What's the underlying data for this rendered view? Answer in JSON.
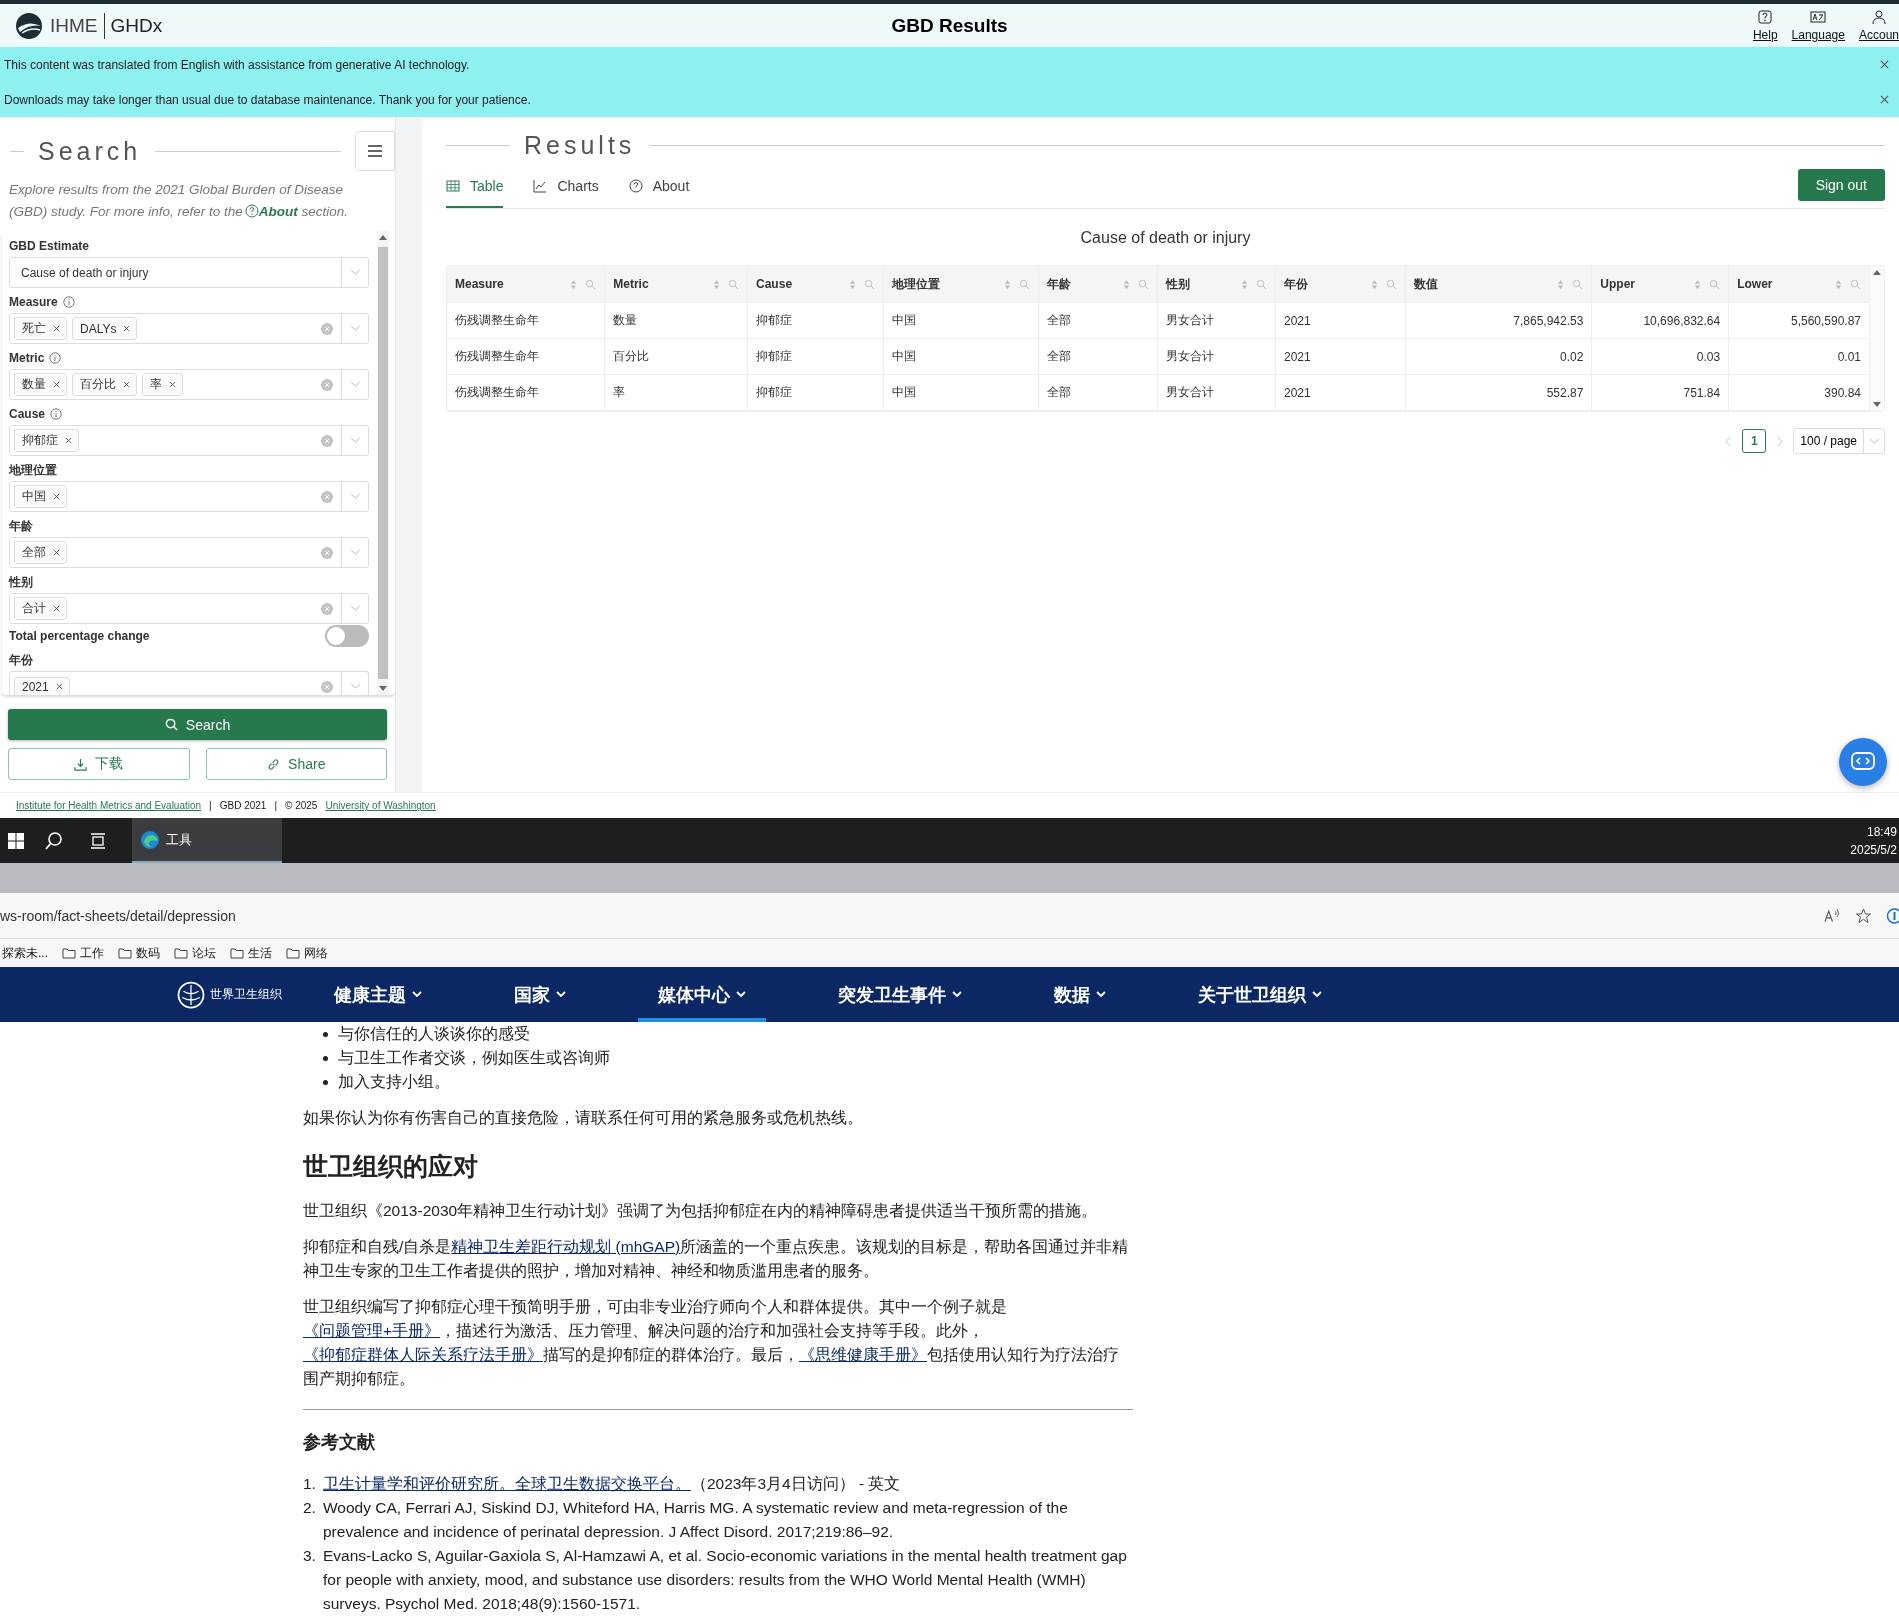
{
  "header": {
    "logo": "IHME",
    "brand": "GHDx",
    "title": "GBD Results",
    "actions": [
      {
        "label": "Help"
      },
      {
        "label": "Language"
      },
      {
        "label": "Accoun"
      }
    ]
  },
  "banners": [
    {
      "text": "This content was translated from English with assistance from generative AI technology."
    },
    {
      "text": "Downloads may take longer than usual due to database maintenance. Thank you for your patience."
    }
  ],
  "search_panel": {
    "title": "Search",
    "intro_before": "Explore results from the 2021 Global Burden of Disease (GBD) study. For more info, refer to the",
    "intro_link": "About",
    "intro_after": "section.",
    "filters": [
      {
        "kind": "select",
        "label": "GBD Estimate",
        "info": false,
        "value": "Cause of death or injury"
      },
      {
        "kind": "tags",
        "label": "Measure",
        "info": true,
        "tags": [
          "死亡",
          "DALYs"
        ]
      },
      {
        "kind": "tags",
        "label": "Metric",
        "info": true,
        "tags": [
          "数量",
          "百分比",
          "率"
        ]
      },
      {
        "kind": "tags",
        "label": "Cause",
        "info": true,
        "tags": [
          "抑郁症"
        ]
      },
      {
        "kind": "tags",
        "label": "地理位置",
        "info": false,
        "tags": [
          "中国"
        ]
      },
      {
        "kind": "tags",
        "label": "年龄",
        "info": false,
        "tags": [
          "全部"
        ]
      },
      {
        "kind": "tags",
        "label": "性别",
        "info": false,
        "tags": [
          "合计"
        ]
      },
      {
        "kind": "toggle",
        "label": "Total percentage change",
        "on": false
      },
      {
        "kind": "tags",
        "label": "年份",
        "info": false,
        "tags": [
          "2021"
        ]
      }
    ],
    "search_button": "Search",
    "download_button": "下载",
    "share_button": "Share"
  },
  "results": {
    "title": "Results",
    "tabs": [
      {
        "label": "Table",
        "selected": true
      },
      {
        "label": "Charts",
        "selected": false
      },
      {
        "label": "About",
        "selected": false
      }
    ],
    "sign_out": "Sign out",
    "table": {
      "caption": "Cause of death or injury",
      "columns": [
        {
          "label": "Measure",
          "kind": "text"
        },
        {
          "label": "Metric",
          "kind": "text"
        },
        {
          "label": "Cause",
          "kind": "text"
        },
        {
          "label": "地理位置",
          "kind": "text"
        },
        {
          "label": "年龄",
          "kind": "text"
        },
        {
          "label": "性别",
          "kind": "text"
        },
        {
          "label": "年份",
          "kind": "text"
        },
        {
          "label": "数值",
          "kind": "number"
        },
        {
          "label": "Upper",
          "kind": "number"
        },
        {
          "label": "Lower",
          "kind": "number"
        }
      ],
      "rows": [
        [
          "伤残调整生命年",
          "数量",
          "抑郁症",
          "中国",
          "全部",
          "男女合计",
          "2021",
          "7,865,942.53",
          "10,696,832.64",
          "5,560,590.87"
        ],
        [
          "伤残调整生命年",
          "百分比",
          "抑郁症",
          "中国",
          "全部",
          "男女合计",
          "2021",
          "0.02",
          "0.03",
          "0.01"
        ],
        [
          "伤残调整生命年",
          "率",
          "抑郁症",
          "中国",
          "全部",
          "男女合计",
          "2021",
          "552.87",
          "751.84",
          "390.84"
        ]
      ]
    },
    "pagination": {
      "pages": [
        {
          "label": "1",
          "selected": true
        }
      ],
      "page_size": "100 / page"
    }
  },
  "footer": [
    {
      "kind": "link",
      "text": "Institute for Health Metrics and Evaluation"
    },
    {
      "kind": "text",
      "text": "|"
    },
    {
      "kind": "text",
      "text": "GBD 2021"
    },
    {
      "kind": "text",
      "text": "|"
    },
    {
      "kind": "text",
      "text": "© 2025"
    },
    {
      "kind": "link",
      "text": "University of Washington"
    }
  ],
  "taskbar": {
    "apps": [
      {
        "label": "工具",
        "selected": true
      }
    ],
    "time": "18:49",
    "date": "2025/5/2"
  },
  "browser": {
    "url": "ws-room/fact-sheets/detail/depression",
    "bookmarks": [
      {
        "kind": "page",
        "label": "探索未..."
      },
      {
        "kind": "folder",
        "label": "工作"
      },
      {
        "kind": "folder",
        "label": "数码"
      },
      {
        "kind": "folder",
        "label": "论坛"
      },
      {
        "kind": "folder",
        "label": "生活"
      },
      {
        "kind": "folder",
        "label": "网络"
      }
    ]
  },
  "site_nav": {
    "logo": "世界卫生组织",
    "items": [
      {
        "label": "健康主题",
        "selected": false
      },
      {
        "label": "国家",
        "selected": false
      },
      {
        "label": "媒体中心",
        "selected": true
      },
      {
        "label": "突发卫生事件",
        "selected": false
      },
      {
        "label": "数据",
        "selected": false
      },
      {
        "label": "关于世卫组织",
        "selected": false
      }
    ]
  },
  "article": {
    "bullets": [
      "与你信任的人谈谈你的感受",
      "与卫生工作者交谈，例如医生或咨询师",
      "加入支持小组。"
    ],
    "paragraph": "如果你认为你有伤害自己的直接危险，请联系任何可用的紧急服务或危机热线。",
    "heading": "世卫组织的应对",
    "paragraphs": [
      [
        {
          "text": "世卫组织《2013-2030年精神卫生行动计划》强调了为包括抑郁症在内的精神障碍患者提供适当干预所需的措施。",
          "kind": "text"
        }
      ],
      [
        {
          "text": "抑郁症和自残/自杀是",
          "kind": "text"
        },
        {
          "text": "精神卫生差距行动规划 (mhGAP)",
          "kind": "link"
        },
        {
          "text": "所涵盖的一个重点疾患。该规划的目标是，帮助各国通过并非精神卫生专家的卫生工作者提供的照护，增加对精神、神经和物质滥用患者的服务。",
          "kind": "text"
        }
      ],
      [
        {
          "text": "世卫组织编写了抑郁症心理干预简明手册，可由非专业治疗师向个人和群体提供。其中一个例子就是",
          "kind": "text"
        },
        {
          "text": "《问题管理+手册》",
          "kind": "link"
        },
        {
          "text": "，描述行为激活、压力管理、解决问题的治疗和加强社会支持等手段。此外，",
          "kind": "text"
        },
        {
          "text": "《抑郁症群体人际关系疗法手册》",
          "kind": "link"
        },
        {
          "text": "描写的是抑郁症的群体治疗。最后，",
          "kind": "text"
        },
        {
          "text": "《思维健康手册》",
          "kind": "link"
        },
        {
          "text": "包括使用认知行为疗法治疗围产期抑郁症。",
          "kind": "text"
        }
      ]
    ],
    "references_heading": "参考文献",
    "references": [
      {
        "number": "1.",
        "parts": [
          {
            "text": "卫生计量学和评价研究所。全球卫生数据交换平台。",
            "kind": "link"
          },
          {
            "text": "（2023年3月4日访问） - 英文",
            "kind": "text"
          }
        ]
      },
      {
        "number": "2.",
        "parts": [
          {
            "text": "Woody CA, Ferrari AJ, Siskind DJ, Whiteford HA, Harris MG. A systematic review and meta-regression of the prevalence and incidence of perinatal depression. J Affect Disord. 2017;219:86–92.",
            "kind": "text"
          }
        ]
      },
      {
        "number": "3.",
        "parts": [
          {
            "text": "Evans-Lacko S, Aguilar-Gaxiola S, Al-Hamzawi A, et al. Socio-economic variations in the mental health treatment gap for people with anxiety, mood, and substance use disorders: results from the WHO World Mental Health (WMH) surveys. Psychol Med. 2018;48(9):1560-1571.",
            "kind": "text"
          }
        ]
      }
    ]
  }
}
